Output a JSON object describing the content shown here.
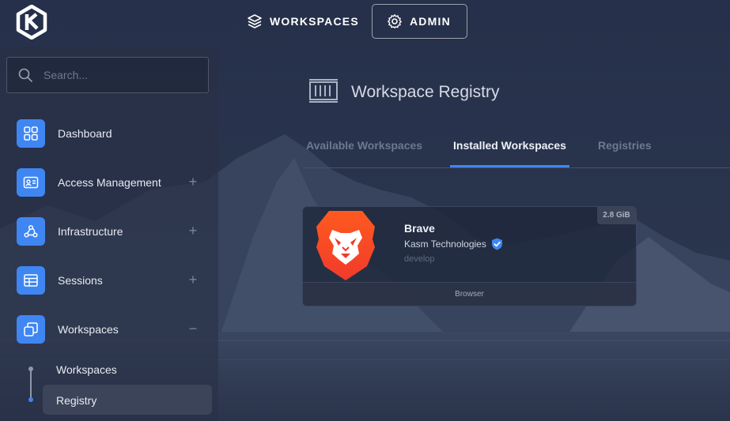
{
  "topbar": {
    "workspaces_label": "WORKSPACES",
    "admin_label": "ADMIN"
  },
  "sidebar": {
    "search_placeholder": "Search...",
    "items": [
      {
        "label": "Dashboard",
        "icon": "grid-icon",
        "expandable": false
      },
      {
        "label": "Access Management",
        "icon": "id-card-icon",
        "expandable": true,
        "state": "collapsed"
      },
      {
        "label": "Infrastructure",
        "icon": "webhook-icon",
        "expandable": true,
        "state": "collapsed"
      },
      {
        "label": "Sessions",
        "icon": "table-icon",
        "expandable": true,
        "state": "collapsed"
      },
      {
        "label": "Workspaces",
        "icon": "windows-icon",
        "expandable": true,
        "state": "expanded"
      }
    ],
    "sub_items": [
      {
        "label": "Workspaces",
        "active": false
      },
      {
        "label": "Registry",
        "active": true
      }
    ]
  },
  "main": {
    "title": "Workspace Registry",
    "tabs": [
      {
        "label": "Available Workspaces",
        "active": false
      },
      {
        "label": "Installed Workspaces",
        "active": true
      },
      {
        "label": "Registries",
        "active": false
      }
    ],
    "cards": [
      {
        "name": "Brave",
        "vendor": "Kasm Technologies",
        "verified": true,
        "tag": "develop",
        "size": "2.8 GiB",
        "category": "Browser",
        "icon": "brave-lion-icon"
      }
    ]
  },
  "colors": {
    "accent": "#3f86f3",
    "brave_orange": "#fb542b",
    "background": "#27314a"
  }
}
